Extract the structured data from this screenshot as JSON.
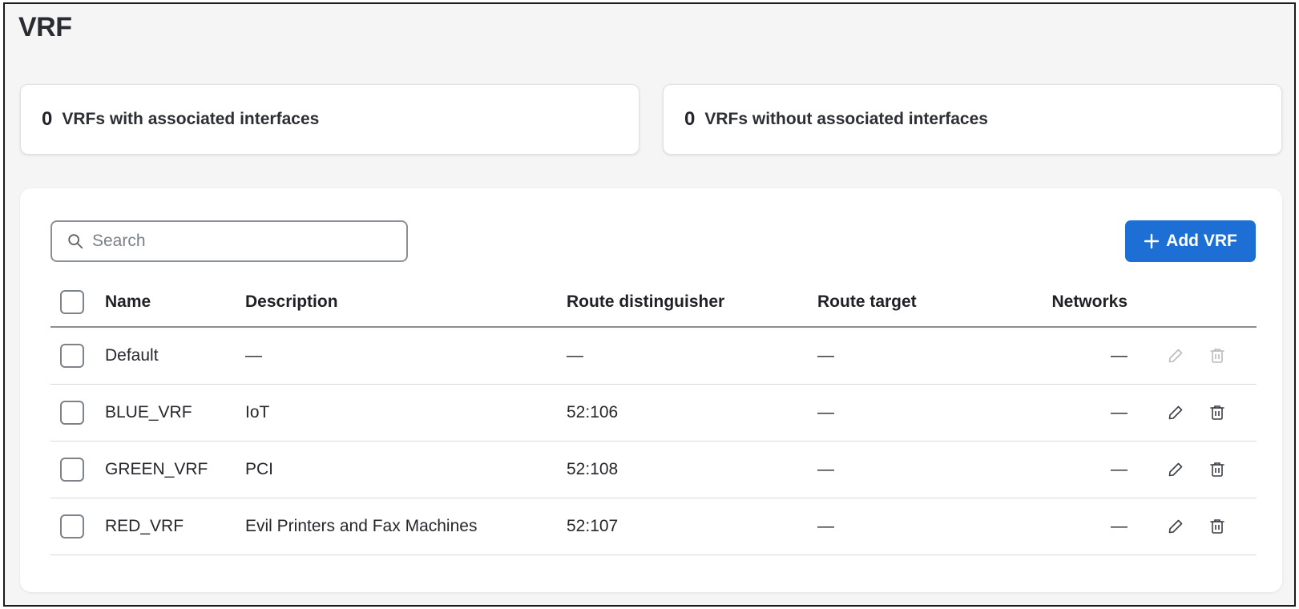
{
  "page": {
    "title": "VRF"
  },
  "stats": [
    {
      "count": "0",
      "label": "VRFs with associated interfaces"
    },
    {
      "count": "0",
      "label": "VRFs without associated interfaces"
    }
  ],
  "toolbar": {
    "search_placeholder": "Search",
    "add_label": "Add VRF",
    "add_color": "#1d6fd6"
  },
  "table": {
    "columns": [
      "Name",
      "Description",
      "Route distinguisher",
      "Route target",
      "Networks"
    ],
    "rows": [
      {
        "name": "Default",
        "description": "—",
        "route_distinguisher": "—",
        "route_target": "—",
        "networks": "—",
        "actions_enabled": false
      },
      {
        "name": "BLUE_VRF",
        "description": "IoT",
        "route_distinguisher": "52:106",
        "route_target": "—",
        "networks": "—",
        "actions_enabled": true
      },
      {
        "name": "GREEN_VRF",
        "description": "PCI",
        "route_distinguisher": "52:108",
        "route_target": "—",
        "networks": "—",
        "actions_enabled": true
      },
      {
        "name": "RED_VRF",
        "description": "Evil Printers and Fax Machines",
        "route_distinguisher": "52:107",
        "route_target": "—",
        "networks": "—",
        "actions_enabled": true
      }
    ]
  },
  "icons": {
    "search": "search-icon",
    "add": "plus-icon",
    "edit": "pencil-icon",
    "delete": "trash-icon"
  }
}
